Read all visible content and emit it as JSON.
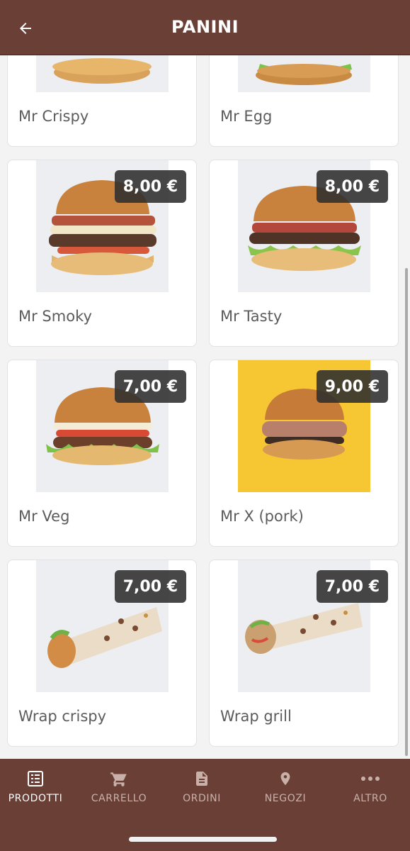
{
  "header": {
    "title": "PANINI",
    "back_icon": "arrow-left-icon"
  },
  "colors": {
    "brand": "#6a4036",
    "badge": "#2d2d2d",
    "nav_inactive": "#c9b1aa",
    "nav_active": "#ffffff"
  },
  "products": [
    {
      "name": "Mr Crispy",
      "price": ""
    },
    {
      "name": "Mr Egg",
      "price": ""
    },
    {
      "name": "Mr Smoky",
      "price": "8,00 €"
    },
    {
      "name": "Mr Tasty",
      "price": "8,00 €"
    },
    {
      "name": "Mr Veg",
      "price": "7,00 €"
    },
    {
      "name": "Mr X (pork)",
      "price": "9,00 €"
    },
    {
      "name": "Wrap crispy",
      "price": "7,00 €"
    },
    {
      "name": "Wrap grill",
      "price": "7,00 €"
    }
  ],
  "nav": [
    {
      "label": "PRODOTTI",
      "icon": "list-icon",
      "active": true
    },
    {
      "label": "CARRELLO",
      "icon": "cart-icon",
      "active": false
    },
    {
      "label": "ORDINI",
      "icon": "document-icon",
      "active": false
    },
    {
      "label": "NEGOZI",
      "icon": "location-pin-icon",
      "active": false
    },
    {
      "label": "ALTRO",
      "icon": "more-dots-icon",
      "active": false
    }
  ]
}
